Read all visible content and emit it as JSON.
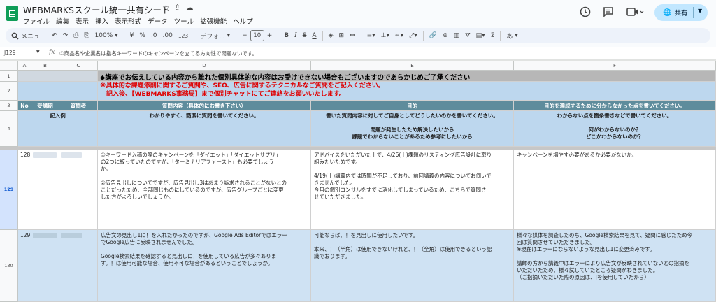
{
  "app": {
    "title": "WEBMARKSスクール統一共有シート",
    "title_icons": [
      "☆",
      "⇪",
      "☁"
    ],
    "menu": [
      "ファイル",
      "編集",
      "表示",
      "挿入",
      "表示形式",
      "データ",
      "ツール",
      "拡張機能",
      "ヘルプ"
    ],
    "share_label": "共有"
  },
  "toolbar": {
    "menu_search": "メニュー",
    "zoom": "100%",
    "currency": "¥",
    "percent": "%",
    "dec_dec": ".0",
    "dec_inc": ".00",
    "number_format": "123",
    "font": "デフォ...",
    "font_size": "10",
    "minus": "−",
    "plus": "+",
    "bold": "B",
    "italic": "I",
    "strike": "S",
    "text_color": "A",
    "sigma": "Σ",
    "input_tool": "あ"
  },
  "formula_bar": {
    "cell_ref": "J129",
    "fx": "fx",
    "value": "①商品名や企業名は指名キーワードのキャンペーンを立てる方向性で問題ないです。"
  },
  "columns": [
    "A",
    "B",
    "C",
    "D",
    "E",
    "F"
  ],
  "rows": {
    "r1": "1",
    "r2": "2",
    "r3": "3",
    "r4": "4",
    "r129": "129",
    "r130": "130"
  },
  "sheet": {
    "notice": "◆講座でお伝えしている内容から離れた個別具体的な内容はお受けできない場合もございますのであらかじめご了承ください",
    "red_line1": "※具体的な課題添削に関するご質問や、SEO、広告に関するテクニカルなご質問をご記入ください。",
    "red_line2": "　記入後、【WEBMARKS事務局】まで個別チャットにてご連絡をお願いいたします。",
    "headers": {
      "no": "No",
      "date": "受講期",
      "person": "質問者",
      "question": "質問内容（具体的にお書き下さい）",
      "purpose": "目的",
      "unknown": "目的を達成するために分からなかった点を書いてください。"
    },
    "example": {
      "label": "記入例",
      "question": "わかりやすく、簡潔に質問を書いてください。",
      "purpose": "書いた質問内容に対してご自身としてどうしたいのかを書いてください。\n\n問題が発生したため解決したいから\n課題でわからないことがあるため参考にしたいから",
      "unknown": "わからない点を箇条書きなどで書いてください。\n\n何がわからないのか？\nどこかわからないのか？"
    },
    "row128": {
      "no": "128",
      "question": "①キーワード入稿の際のキャンペーンを「ダイエット」「ダイエットサプリ」\nの2つに絞っていたのですが、「ターミナリアファースト」も必要でしょう\nか。\n\n②広告見出しについてですが、広告見出し3はあまり訴求されることがないとの\nことだったため、全部同じものにしているのですが、広告グループごとに変更\nした方がよろしいでしょうか。",
      "purpose": "アドバイスをいただいた上で、4/26(土)課題のリスティング広告設計に取り\n組みたいためです。\n\n4/19(土)講義内では時間が不足しており、前回講義の内容についてお伺いで\nきませんでした。\n今月の個別コンサルをすでに消化してしまっているため、こちらで質問さ\nせていただきました。",
      "unknown": "キャンペーンを増やす必要があるか必要がないか。"
    },
    "row129": {
      "no": "129",
      "question": "広告文の見出し1に！を入れたかったのですが、Google Ads Editorではエラー\nでGoogle広告に反映されませんでした。\n\nGoogle検索結果を確認すると見出しに！を使用している広告が多々ありま\nす。！は使用可能な場合、使用不可な場合があるということでしょうか。",
      "purpose": "可能ならば、！を見出しに使用したいです。\n\n本来、！（半角）は使用できないけれど、！（全角）は使用できるという認\n識でおります。",
      "unknown": "様々な媒体を調査したのち、Google検索結果を見て、疑問に感じたため今\n回は質問させていただきました。\n※現在はエラーにならないような見出し1に変更済みです。\n\n講師の方から講義中はエラーにより広告文が反映されていないとの指摘を\nいただいたため、様々試していたところ疑問がわきました。\n（ご指摘いただいた際の原因は、|を使用していたから）"
    }
  },
  "colors": {
    "header_teal": "#5e8c9c",
    "example_blue": "#bdd7ee",
    "gray_band": "#b7b7b7",
    "red_text": "#e00000",
    "share_bg": "#c2e7ff"
  }
}
